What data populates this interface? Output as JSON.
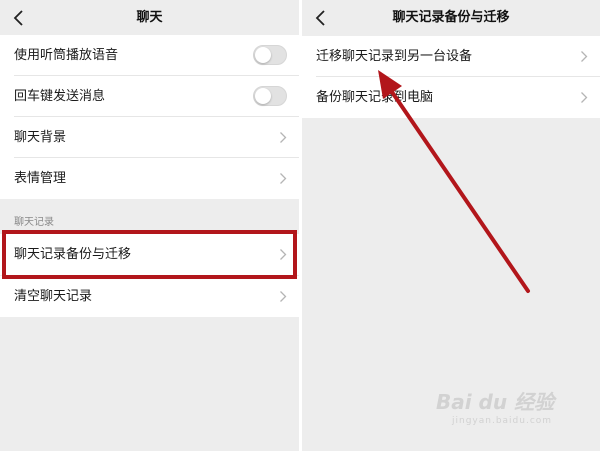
{
  "left_panel": {
    "title": "聊天",
    "rows": [
      {
        "label": "使用听筒播放语音",
        "control": "toggle",
        "on": false
      },
      {
        "label": "回车键发送消息",
        "control": "toggle",
        "on": false
      },
      {
        "label": "聊天背景",
        "control": "chevron"
      },
      {
        "label": "表情管理",
        "control": "chevron"
      }
    ],
    "section_header": "聊天记录",
    "section_rows": [
      {
        "label": "聊天记录备份与迁移",
        "control": "chevron"
      },
      {
        "label": "清空聊天记录",
        "control": "chevron"
      }
    ]
  },
  "right_panel": {
    "title": "聊天记录备份与迁移",
    "rows": [
      {
        "label": "迁移聊天记录到另一台设备",
        "control": "chevron"
      },
      {
        "label": "备份聊天记录到电脑",
        "control": "chevron"
      }
    ]
  },
  "annotation_color": "#b2161b",
  "icons": {
    "back": "back-chevron-icon",
    "row_arrow": "chevron-right-icon"
  },
  "watermark": {
    "text": "Bai du 经验",
    "sub": "jingyan.baidu.com"
  }
}
